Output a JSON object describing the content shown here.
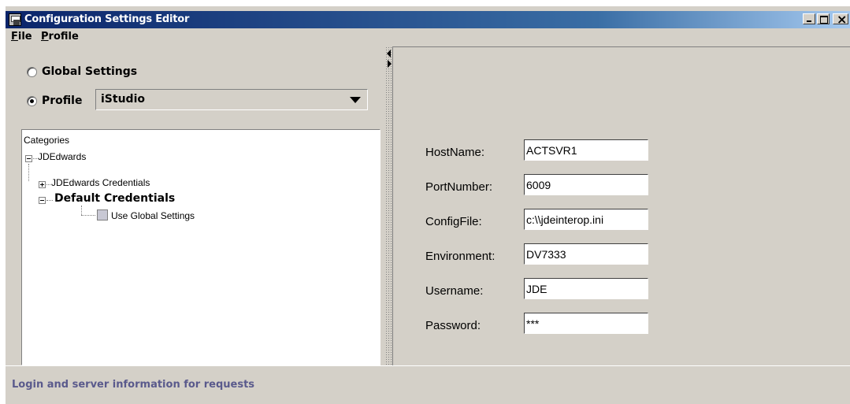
{
  "window": {
    "title": "Configuration Settings Editor"
  },
  "menu": {
    "file_accel": "F",
    "file_rest": "ile",
    "profile_accel": "P",
    "profile_rest": "rofile"
  },
  "scope": {
    "global_label": "Global Settings",
    "global_selected": false,
    "profile_label": "Profile",
    "profile_selected": true,
    "profile_value": "iStudio"
  },
  "tree": {
    "root_label": "Categories",
    "nodes": [
      {
        "label": "JDEdwards",
        "expanded": true
      },
      {
        "label": "JDEdwards Credentials",
        "expanded": false
      },
      {
        "label": "Default Credentials",
        "expanded": true
      },
      {
        "label": "Use Global Settings",
        "checked": false
      }
    ]
  },
  "fields": [
    {
      "label": "HostName:",
      "value": "ACTSVR1"
    },
    {
      "label": "PortNumber:",
      "value": "6009"
    },
    {
      "label": "ConfigFile:",
      "value": "c:\\\\jdeinterop.ini"
    },
    {
      "label": "Environment:",
      "value": "DV7333"
    },
    {
      "label": "Username:",
      "value": "JDE"
    },
    {
      "label": "Password:",
      "value": "***"
    }
  ],
  "status": {
    "text": "Login and server information for requests"
  },
  "colors": {
    "titlebar_start": "#0a246a",
    "titlebar_end": "#a6caf0",
    "window_bg": "#d4d0c8",
    "status_text": "#5a5a8c"
  }
}
